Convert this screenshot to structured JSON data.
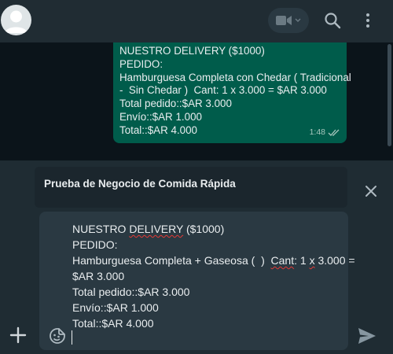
{
  "header": {
    "avatar_icon": "default-avatar-icon",
    "video_icon": "video-call-icon",
    "video_chevron_icon": "chevron-down-icon",
    "search_icon": "search-icon",
    "menu_icon": "kebab-menu-icon"
  },
  "message": {
    "lines": [
      "NUESTRO DELIVERY ($1000)",
      "PEDIDO:",
      "Hamburguesa Completa con Chedar ( Tradicional",
      "-  Sin Chedar )  Cant: 1 x 3.000 = $AR 3.000",
      "Total pedido::$AR 3.000",
      "Envío::$AR 1.000",
      "Total::$AR 4.000"
    ],
    "time": "1:48",
    "status_icon": "double-check-icon"
  },
  "reply": {
    "quoted_title": "Prueba de Negocio de Comida Rápida",
    "close_icon": "close-icon"
  },
  "compose": {
    "line1_a": "NUESTRO ",
    "line1_b": "DELIVERY",
    "line1_c": " ($1000)",
    "line2": "PEDIDO:",
    "line3_a": "Hamburguesa Completa + Gaseosa (  )  ",
    "line3_b": "Cant",
    "line3_c": ": 1 ",
    "line3_d": "x",
    "line3_e": " 3.000 =",
    "line4": "$AR 3.000",
    "line5": "Total pedido::$AR 3.000",
    "line6": "Envío::$AR 1.000",
    "line7": "Total::$AR 4.000",
    "sticker_icon": "sticker-icon",
    "attach_icon": "plus-icon",
    "send_icon": "send-icon"
  },
  "colors": {
    "header_bg": "#202c33",
    "chat_bg": "#0b141a",
    "outgoing_bubble": "#005c4b",
    "compose_bg": "#2a3942",
    "text": "#e9edef",
    "icon": "#aebac1"
  }
}
